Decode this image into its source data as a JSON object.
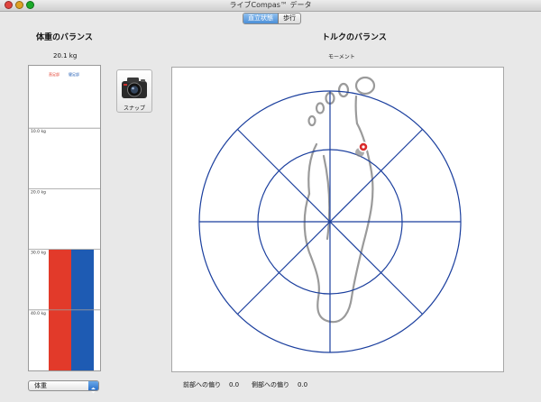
{
  "window": {
    "title": "ライブCompas™ データ"
  },
  "mode_tabs": [
    {
      "label": "直立状態",
      "selected": true
    },
    {
      "label": "歩行",
      "selected": false
    }
  ],
  "weight_panel": {
    "heading": "体重のバランス",
    "value": "20.1 kg",
    "legend": {
      "left": "直足部",
      "right": "健足部"
    },
    "y_ticks": [
      "40.0 kg",
      "30.0 kg",
      "20.0 kg",
      "10.0 kg"
    ]
  },
  "snapshot_button": {
    "label": "スナップ",
    "icon": "camera-icon"
  },
  "torque_panel": {
    "heading": "トルクのバランス",
    "subtitle": "モーメント"
  },
  "readouts": {
    "front": {
      "label": "前部への偏り",
      "value": "0.0"
    },
    "side": {
      "label": "側部への偏り",
      "value": "0.0"
    }
  },
  "metric_select": {
    "value": "体重"
  },
  "colors": {
    "left_bar": "#e23a2a",
    "right_bar": "#1e5bb3",
    "target_lines": "#1b3f9e",
    "marker": "#d92b2b",
    "select_accent": "#2a6fc8"
  },
  "chart_data": {
    "type": "bar",
    "categories": [
      "直足部",
      "健足部"
    ],
    "values": [
      20,
      20
    ],
    "ylim": [
      0,
      50
    ],
    "y_ticks": [
      10,
      20,
      30,
      40
    ],
    "grid": true
  }
}
